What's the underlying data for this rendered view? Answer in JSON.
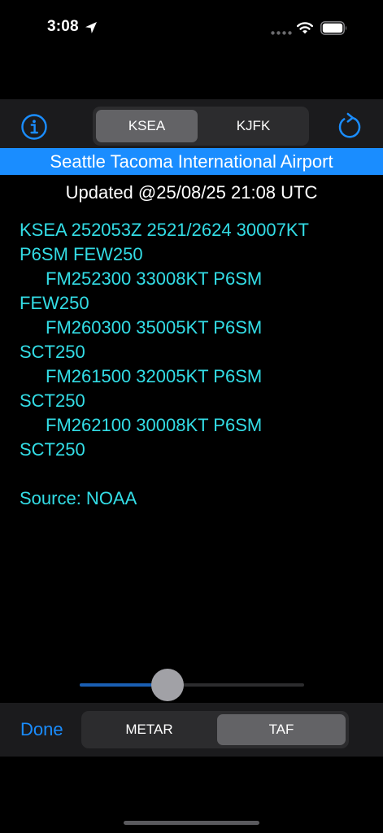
{
  "status_bar": {
    "time": "3:08"
  },
  "toolbar": {
    "airports": [
      {
        "label": "KSEA",
        "selected": true
      },
      {
        "label": "KJFK",
        "selected": false
      }
    ]
  },
  "banner": {
    "airport_name": "Seattle Tacoma International Airport"
  },
  "updated": "Updated @25/08/25 21:08 UTC",
  "report_lines": [
    {
      "text": "KSEA 252053Z 2521/2624 30007KT",
      "indent": false
    },
    {
      "text": "P6SM FEW250",
      "indent": false
    },
    {
      "text": "FM252300 33008KT P6SM",
      "indent": true
    },
    {
      "text": "FEW250",
      "indent": false
    },
    {
      "text": "FM260300 35005KT P6SM",
      "indent": true
    },
    {
      "text": "SCT250",
      "indent": false
    },
    {
      "text": "FM261500 32005KT P6SM",
      "indent": true
    },
    {
      "text": "SCT250",
      "indent": false
    },
    {
      "text": "FM262100 30008KT P6SM",
      "indent": true
    },
    {
      "text": "SCT250",
      "indent": false
    },
    {
      "text": "",
      "indent": false
    },
    {
      "text": "Source: NOAA",
      "indent": false
    }
  ],
  "slider": {
    "value": 0.39
  },
  "bottom_toolbar": {
    "done_label": "Done",
    "modes": [
      {
        "label": "METAR",
        "selected": false
      },
      {
        "label": "TAF",
        "selected": true
      }
    ]
  },
  "colors": {
    "accent": "#1a8dff",
    "report_text": "#33dde6",
    "background": "#000000"
  }
}
